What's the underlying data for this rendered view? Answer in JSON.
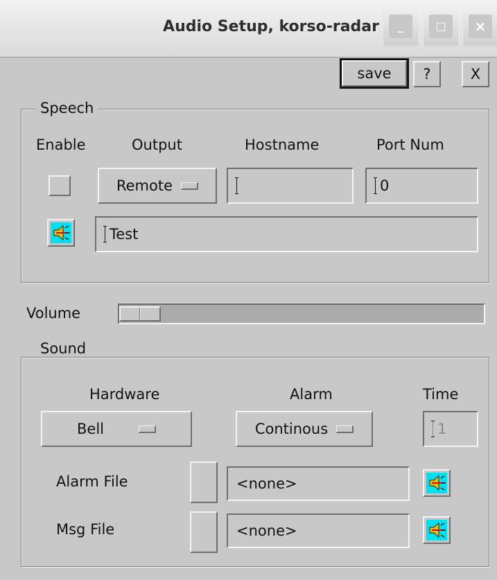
{
  "window": {
    "title": "Audio Setup, korso-radar",
    "minimize_label": "_",
    "maximize_label": "□",
    "close_label": "×"
  },
  "toolbar": {
    "save_label": "save",
    "help_label": "?",
    "close_label": "X"
  },
  "speech": {
    "group_label": "Speech",
    "headers": {
      "enable": "Enable",
      "output": "Output",
      "hostname": "Hostname",
      "port": "Port Num"
    },
    "output_value": "Remote",
    "hostname_value": "",
    "port_value": "0",
    "test_text": "Test"
  },
  "volume": {
    "label": "Volume",
    "level_fraction": 0.1
  },
  "sound": {
    "group_label": "Sound",
    "headers": {
      "hardware": "Hardware",
      "alarm": "Alarm",
      "time": "Time"
    },
    "hardware_value": "Bell",
    "alarm_value": "Continous",
    "time_value": "1",
    "alarm_file_label": "Alarm File",
    "alarm_file_value": "<none>",
    "msg_file_label": "Msg File",
    "msg_file_value": "<none>"
  },
  "colors": {
    "background": "#c8c8c8",
    "speaker_icon_bg": "#00e0f0",
    "speaker_icon_body": "#f0c000",
    "speaker_icon_accent": "#e00000"
  },
  "icons": {
    "speaker": "speaker-icon"
  }
}
